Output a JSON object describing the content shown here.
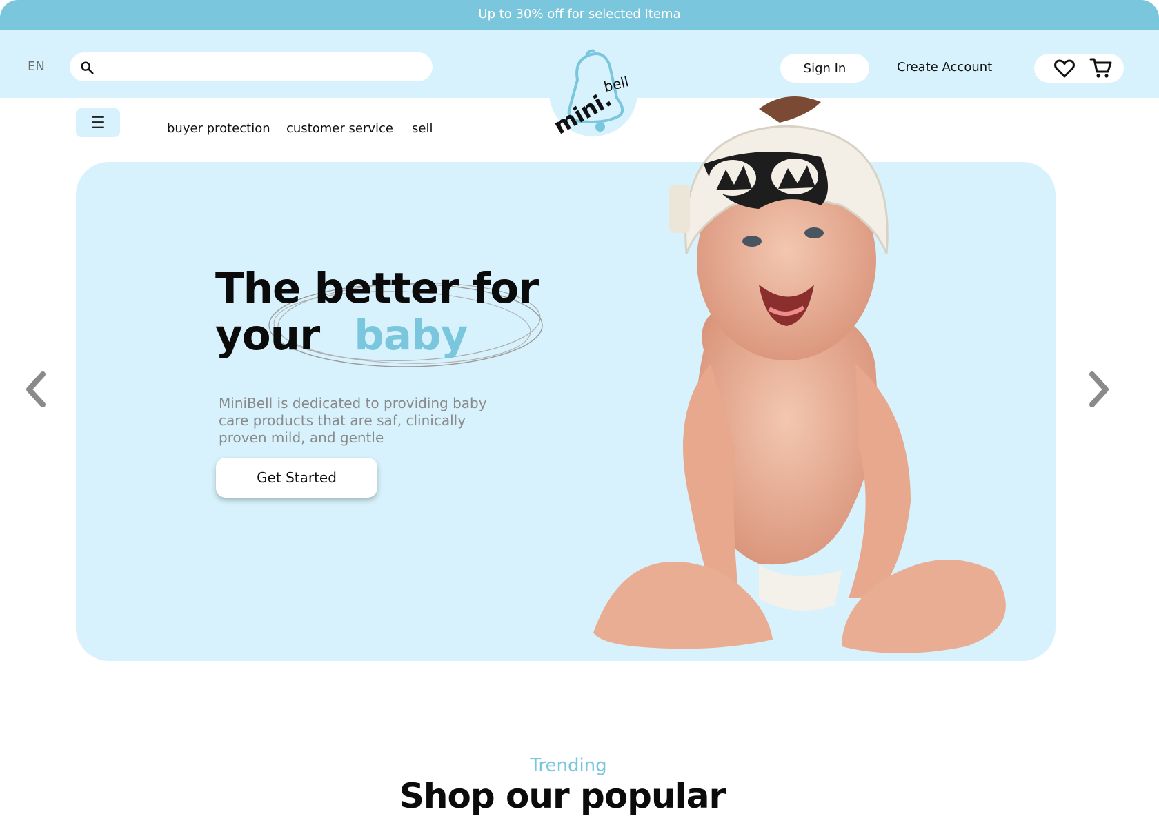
{
  "promo": {
    "text": "Up to 30% off for selected Itema"
  },
  "header": {
    "language": "EN",
    "search": {
      "placeholder": "",
      "value": ""
    },
    "logo": {
      "text": "mini.bell"
    },
    "sign_in": "Sign In",
    "create_account": "Create Account"
  },
  "nav": {
    "links": [
      "buyer protection",
      "customer service",
      "sell"
    ]
  },
  "hero": {
    "title_line1": "The better for",
    "title_line2_a": "your",
    "title_line2_b": "baby",
    "description": "MiniBell is dedicated to providing baby care products that are saf, clinically proven mild, and gentle",
    "cta": "Get Started"
  },
  "section": {
    "eyebrow": "Trending",
    "title": "Shop our popular"
  },
  "colors": {
    "accent": "#7ac6dd",
    "light_blue": "#d7f2fc",
    "text": "#0b0b0b"
  },
  "icons": [
    "search-icon",
    "heart-icon",
    "cart-icon",
    "menu-icon",
    "chevron-left-icon",
    "chevron-right-icon"
  ]
}
